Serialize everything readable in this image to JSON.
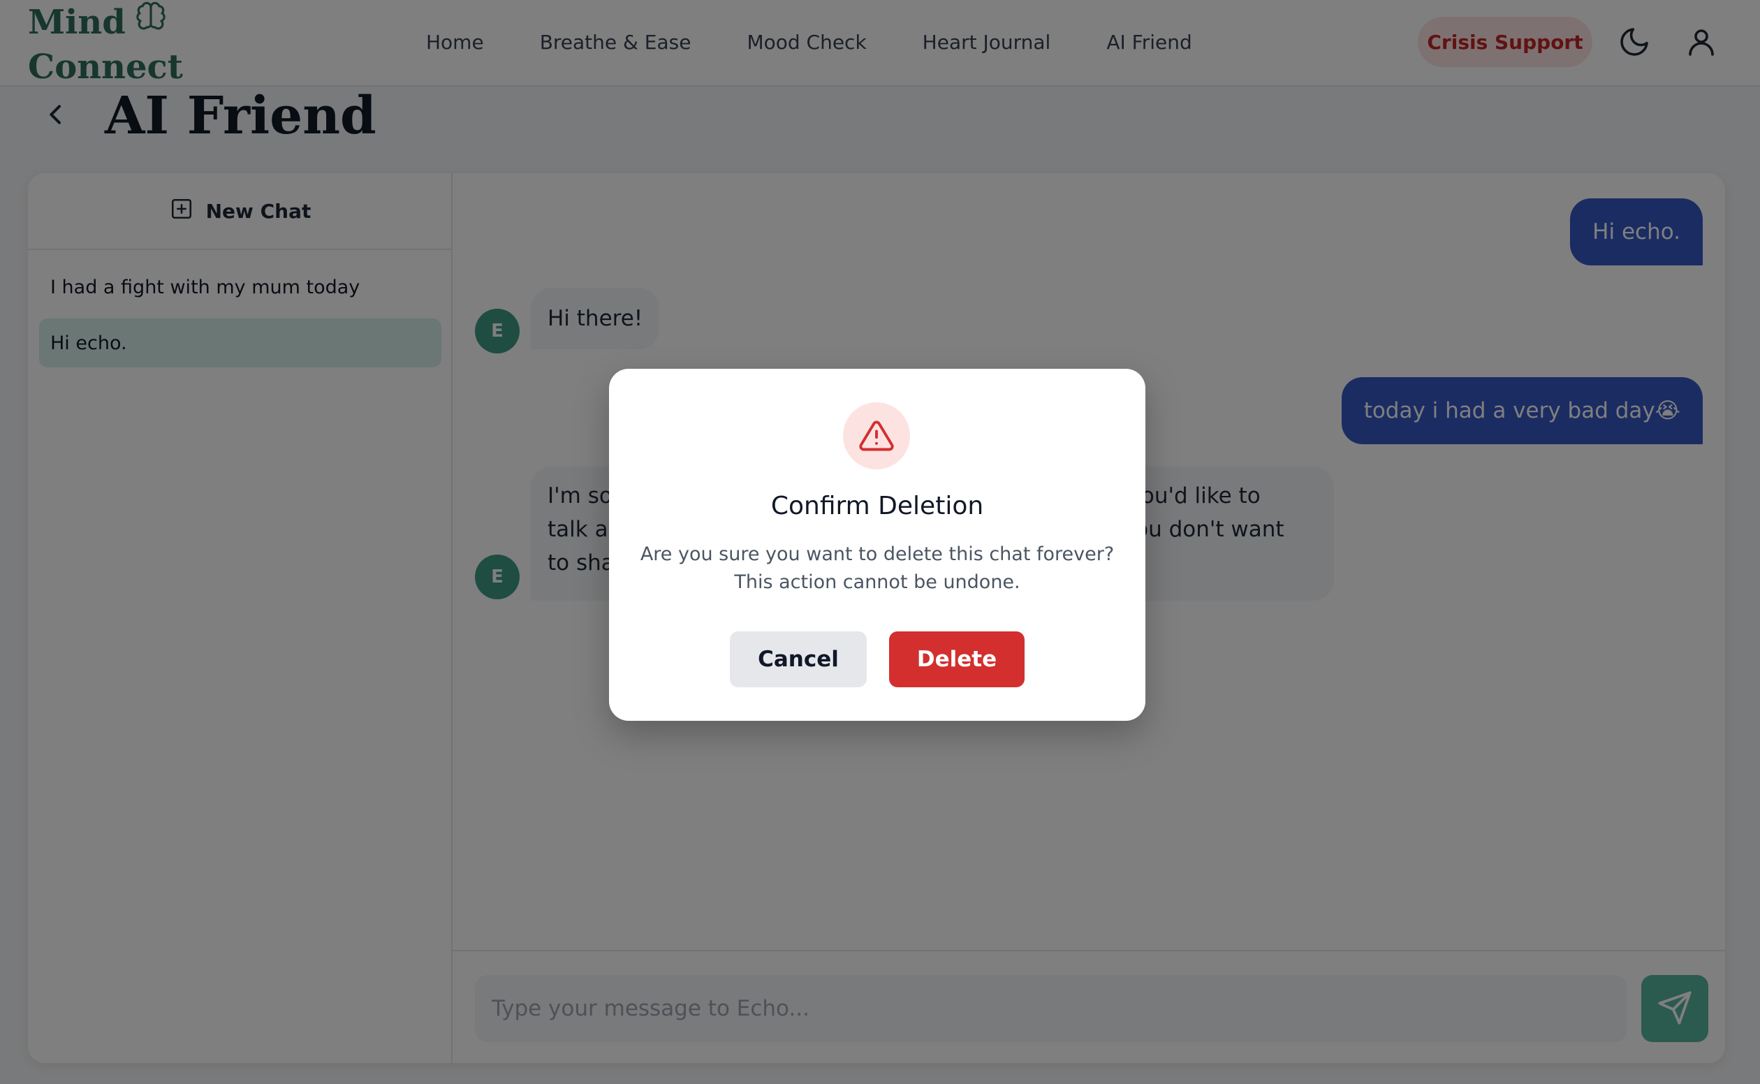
{
  "header": {
    "logo_line1": "Mind",
    "logo_line2": "Connect",
    "logo_icon": "brain-icon",
    "nav": [
      "Home",
      "Breathe & Ease",
      "Mood Check",
      "Heart Journal",
      "AI Friend"
    ],
    "crisis_label": "Crisis Support",
    "theme_icon": "moon-icon",
    "profile_icon": "user-icon"
  },
  "page": {
    "title": "AI Friend",
    "back_icon": "chevron-left-icon"
  },
  "sidebar": {
    "new_chat_label": "New Chat",
    "new_chat_icon": "plus-square-icon",
    "chats": [
      {
        "title": "I had a fight with my mum today",
        "active": false
      },
      {
        "title": "Hi echo.",
        "active": true
      }
    ]
  },
  "messages": [
    {
      "role": "user",
      "text": "Hi echo."
    },
    {
      "role": "bot",
      "avatar": "E",
      "text": "Hi there!"
    },
    {
      "role": "user",
      "text": "today i had a very bad day😭"
    },
    {
      "role": "bot",
      "avatar": "E",
      "text_lines": [
        "I'm so",
        "talk ab",
        "to sha",
        "g you'd like to",
        "f you don't want"
      ]
    }
  ],
  "composer": {
    "placeholder": "Type your message to Echo...",
    "send_icon": "send-icon"
  },
  "modal": {
    "icon": "warning-triangle-icon",
    "title": "Confirm Deletion",
    "line1": "Are you sure you want to delete this chat forever?",
    "line2": "This action cannot be undone.",
    "cancel_label": "Cancel",
    "delete_label": "Delete"
  },
  "colors": {
    "brand": "#2f6e5c",
    "user_bubble": "#3758c7",
    "avatar": "#3f9a82",
    "send": "#56b59c",
    "danger": "#d32f2f",
    "crisis_bg": "#fde2e2",
    "crisis_text": "#c02626"
  }
}
